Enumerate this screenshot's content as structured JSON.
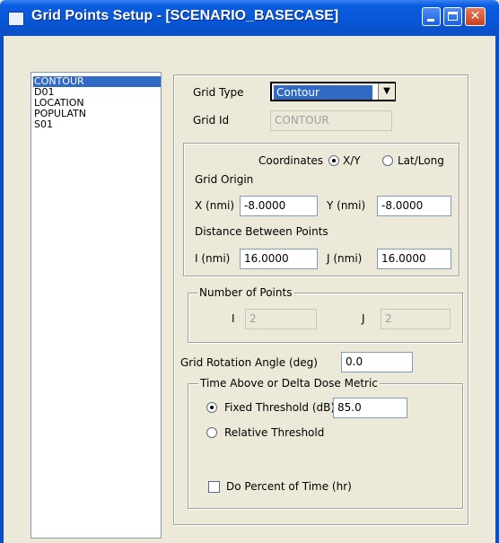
{
  "window": {
    "title": "Grid Points Setup - [SCENARIO_BASECASE]",
    "min_icon": "minimize-icon",
    "max_icon": "maximize-icon",
    "close_icon": "close-icon",
    "close_glyph": "✕"
  },
  "grid_list": {
    "items": [
      "CONTOUR",
      "D01",
      "LOCATION",
      "POPULATN",
      "S01"
    ],
    "selected": "CONTOUR"
  },
  "grid_type": {
    "label": "Grid Type",
    "value": "Contour",
    "arrow": "▼"
  },
  "grid_id": {
    "label": "Grid Id",
    "value": "CONTOUR"
  },
  "coordinates": {
    "label": "Coordinates",
    "option_xy": "X/Y",
    "option_latlong": "Lat/Long",
    "selected": "X/Y"
  },
  "grid_origin": {
    "title": "Grid Origin",
    "x_label": "X (nmi)",
    "x_value": "-8.0000",
    "y_label": "Y (nmi)",
    "y_value": "-8.0000"
  },
  "distance": {
    "title": "Distance Between Points",
    "i_label": "I (nmi)",
    "i_value": "16.0000",
    "j_label": "J (nmi)",
    "j_value": "16.0000"
  },
  "num_points": {
    "title": "Number of Points",
    "i_label": "I",
    "i_value": "2",
    "j_label": "J",
    "j_value": "2"
  },
  "rotation": {
    "label": "Grid Rotation Angle (deg)",
    "value": "0.0"
  },
  "metric": {
    "title": "Time Above or Delta Dose Metric",
    "fixed_label": "Fixed Threshold (dB)",
    "fixed_value": "85.0",
    "relative_label": "Relative Threshold",
    "selected": "Fixed Threshold (dB)",
    "percent_label": "Do Percent of Time (hr)",
    "percent_checked": false
  },
  "colors": {
    "title_bar": "#0a5de0",
    "selection": "#316ac5",
    "face": "#ece9d8",
    "close_button": "#c8401c"
  }
}
